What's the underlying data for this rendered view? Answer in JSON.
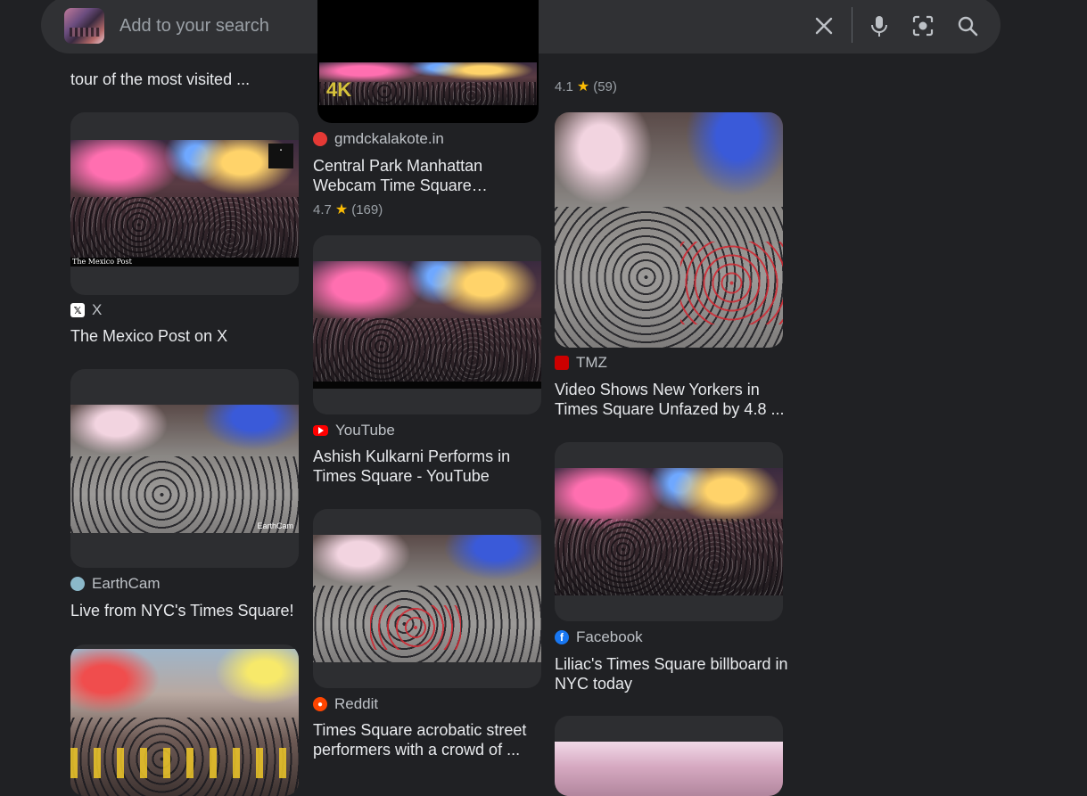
{
  "search": {
    "placeholder": "Add to your search",
    "clear_icon": "close-icon",
    "voice_icon": "microphone-icon",
    "lens_icon": "lens-icon",
    "search_icon": "search-icon"
  },
  "colors": {
    "background": "#202124",
    "search_bar": "#303134",
    "text_primary": "#e8eaed",
    "text_secondary": "#bdc1c6",
    "star": "#fbbc04"
  },
  "results": {
    "col1_top_title": "tour of the most visited ...",
    "col2_top": {
      "badge": "4K"
    },
    "col3_top": {
      "rating": "4.1",
      "reviews": "(59)"
    },
    "mexico": {
      "watermark": "The Mexico Post",
      "source": "X",
      "title": "The Mexico Post on X"
    },
    "earthcam": {
      "watermark": "EarthCam",
      "source": "EarthCam",
      "title": "Live from NYC's Times Square!"
    },
    "gmdc": {
      "source": "gmdckalakote.in",
      "title": "Central Park Manhattan Webcam Time Square…",
      "rating": "4.7",
      "reviews": "(169)"
    },
    "youtube": {
      "source": "YouTube",
      "title": "Ashish Kulkarni Performs in Times Square - YouTube"
    },
    "reddit": {
      "source": "Reddit",
      "title": "Times Square acrobatic street performers with a crowd of ..."
    },
    "tmz": {
      "source": "TMZ",
      "title": "Video Shows New Yorkers in Times Square Unfazed by 4.8 ..."
    },
    "facebook": {
      "source": "Facebook",
      "title": "Liliac's Times Square billboard in NYC today"
    }
  }
}
